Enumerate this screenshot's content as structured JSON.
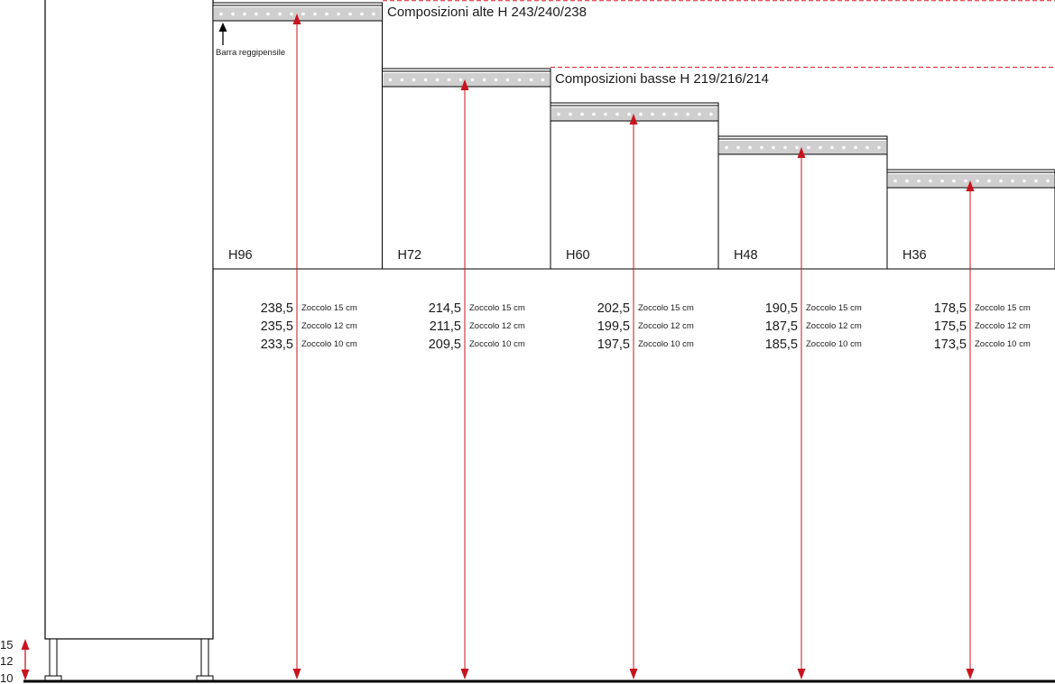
{
  "labels": {
    "alte": "Composizioni alte H 243/240/238",
    "basse": "Composizioni basse H 219/216/214",
    "barra": "Barra reggipensile"
  },
  "legs": {
    "h15": "15",
    "h12": "12",
    "h10": "10"
  },
  "modules": [
    {
      "name": "H96",
      "values": [
        "238,5",
        "235,5",
        "233,5"
      ]
    },
    {
      "name": "H72",
      "values": [
        "214,5",
        "211,5",
        "209,5"
      ]
    },
    {
      "name": "H60",
      "values": [
        "202,5",
        "199,5",
        "197,5"
      ]
    },
    {
      "name": "H48",
      "values": [
        "190,5",
        "187,5",
        "185,5"
      ]
    },
    {
      "name": "H36",
      "values": [
        "178,5",
        "175,5",
        "173,5"
      ]
    }
  ],
  "zoccoli": [
    "Zoccolo 15 cm",
    "Zoccolo 12 cm",
    "Zoccolo 10 cm"
  ],
  "colors": {
    "arrow": "#c8141e",
    "dash": "#d9232e",
    "bar": "#cfcfcf",
    "line": "#000000"
  }
}
